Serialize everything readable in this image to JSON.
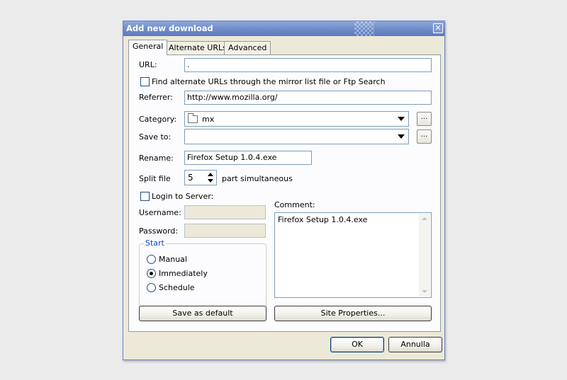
{
  "dialog": {
    "title": "Add new download",
    "close_glyph": "✕"
  },
  "tabs": [
    {
      "label": "General",
      "active": true
    },
    {
      "label": "Alternate URLs",
      "active": false
    },
    {
      "label": "Advanced",
      "active": false
    }
  ],
  "general": {
    "url_label": "URL:",
    "url_value": ".",
    "mirror_checkbox_label": "Find alternate URLs through the mirror list file or Ftp Search",
    "mirror_checked": false,
    "referrer_label": "Referrer:",
    "referrer_value": "http://www.mozilla.org/",
    "category_label": "Category:",
    "category_value": "mx",
    "category_icon": "folder-icon",
    "save_to_label": "Save to:",
    "save_to_value": "",
    "browse_label": "...",
    "rename_label": "Rename:",
    "rename_value": "Firefox Setup 1.0.4.exe",
    "split_label": "Split file",
    "split_value": "5",
    "split_suffix": "part simultaneous",
    "login_label": "Login to Server:",
    "login_checked": false,
    "username_label": "Username:",
    "username_value": "",
    "password_label": "Password:",
    "password_value": "",
    "start_group_label": "Start",
    "start_options": [
      {
        "label": "Manual",
        "checked": false
      },
      {
        "label": "Immediately",
        "checked": true
      },
      {
        "label": "Schedule",
        "checked": false
      }
    ],
    "comment_label": "Comment:",
    "comment_value": "Firefox Setup 1.0.4.exe",
    "save_default_label": "Save as default",
    "site_properties_label": "Site Properties..."
  },
  "footer": {
    "ok_label": "OK",
    "cancel_label": "Annulla"
  },
  "colors": {
    "titlebar": "#6e8bc9",
    "dialog_bg": "#ece9d8",
    "panel_bg": "#fcfcfe",
    "group_label": "#0046d5"
  }
}
